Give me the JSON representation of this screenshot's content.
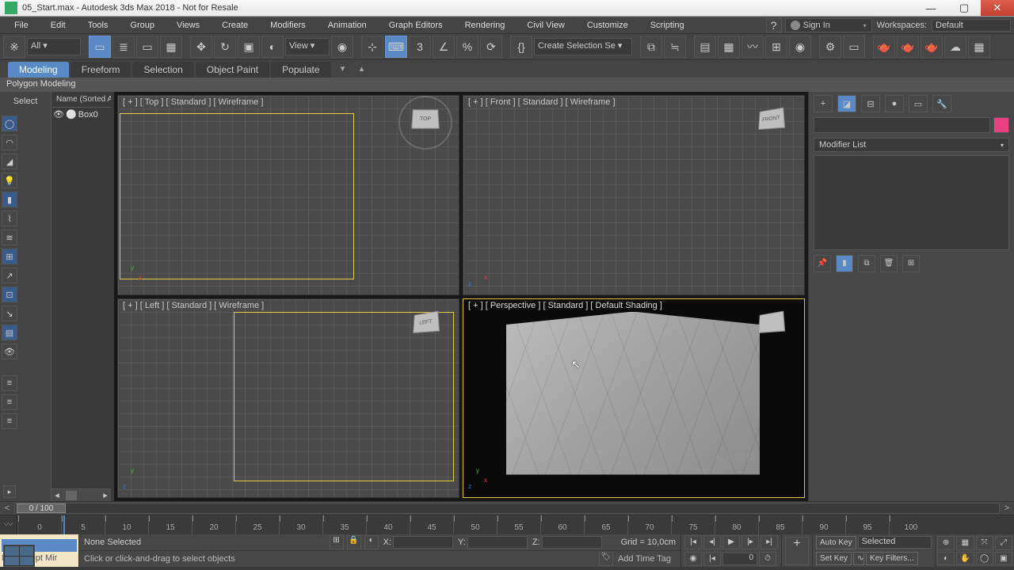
{
  "title": "05_Start.max - Autodesk 3ds Max 2018 - Not for Resale",
  "menu": [
    "File",
    "Edit",
    "Tools",
    "Group",
    "Views",
    "Create",
    "Modifiers",
    "Animation",
    "Graph Editors",
    "Rendering",
    "Civil View",
    "Customize",
    "Scripting"
  ],
  "signin": "Sign In",
  "workspaces_label": "Workspaces:",
  "workspace": "Default",
  "toolbar": {
    "all": "All",
    "view": "View",
    "create_sel_set": "Create Selection Se"
  },
  "ribbon_tabs": [
    "Modeling",
    "Freeform",
    "Selection",
    "Object Paint",
    "Populate"
  ],
  "ribbon_strip": "Polygon Modeling",
  "left_select": "Select",
  "scene": {
    "header": "Name (Sorted A",
    "items": [
      "Box0"
    ]
  },
  "viewports": {
    "top": "[ + ] [ Top ] [ Standard ] [ Wireframe ]",
    "front": "[ + ] [ Front ] [ Standard ] [ Wireframe ]",
    "left": "[ + ] [ Left ] [ Standard ] [ Wireframe ]",
    "persp": "[ + ] [ Perspective ] [ Standard ] [ Default Shading ]",
    "cube_top": "TOP",
    "cube_front": "FRONT",
    "cube_left": "LEFT",
    "cube_persp": ""
  },
  "command_panel": {
    "modlist": "Modifier List"
  },
  "frame_handle": "0 / 100",
  "track_marks": [
    0,
    5,
    10,
    15,
    20,
    25,
    30,
    35,
    40,
    45,
    50,
    55,
    60,
    65,
    70,
    75,
    80,
    85,
    90,
    95,
    100
  ],
  "status": {
    "selection": "None Selected",
    "prompt": "Click or click-and-drag to select objects",
    "x": "X:",
    "y": "Y:",
    "z": "Z:",
    "grid": "Grid = 10,0cm",
    "add_time_tag": "Add Time Tag"
  },
  "anim": {
    "autokey": "Auto Key",
    "setkey": "Set Key",
    "selected": "Selected",
    "keyfilters": "Key Filters...",
    "frame": "0"
  },
  "maxscript": "MAXScript Mir"
}
